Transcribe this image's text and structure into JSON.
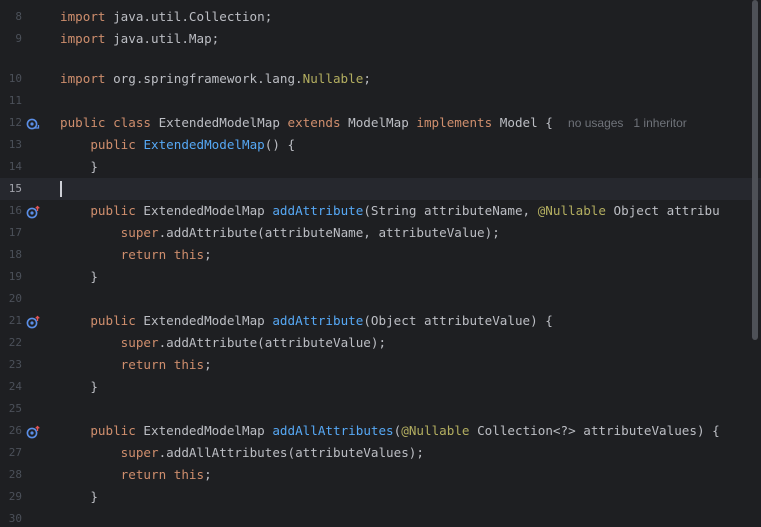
{
  "editor": {
    "current_line": "15",
    "lines": [
      {
        "num": "8",
        "indent": "",
        "tokens": [
          [
            "kw",
            "import"
          ],
          [
            "t",
            " java.util.Collection;"
          ]
        ]
      },
      {
        "num": "9",
        "indent": "",
        "tokens": [
          [
            "kw",
            "import"
          ],
          [
            "t",
            " java.util.Map;"
          ]
        ]
      },
      {
        "num": "10",
        "indent": "",
        "tokens": [
          [
            "kw",
            "import"
          ],
          [
            "t",
            " org.springframework.lang."
          ],
          [
            "an",
            "Nullable"
          ],
          [
            "t",
            ";"
          ]
        ]
      },
      {
        "num": "11",
        "indent": "",
        "tokens": []
      },
      {
        "num": "12",
        "indent": "",
        "icon": "implementation-icon",
        "tokens": [
          [
            "kw",
            "public class"
          ],
          [
            "t",
            " ExtendedModelMap "
          ],
          [
            "kw",
            "extends"
          ],
          [
            "t",
            " ModelMap "
          ],
          [
            "kw",
            "implements"
          ],
          [
            "t",
            " Model {  "
          ],
          [
            "hint",
            "no usages   1 inheritor"
          ]
        ]
      },
      {
        "num": "13",
        "indent": "    ",
        "tokens": [
          [
            "kw",
            "public"
          ],
          [
            "t",
            " "
          ],
          [
            "fn",
            "ExtendedModelMap"
          ],
          [
            "t",
            "() {"
          ]
        ]
      },
      {
        "num": "14",
        "indent": "    ",
        "tokens": [
          [
            "t",
            "}"
          ]
        ]
      },
      {
        "num": "15",
        "indent": "",
        "tokens": []
      },
      {
        "num": "16",
        "indent": "    ",
        "icon": "override-icon",
        "tokens": [
          [
            "kw",
            "public"
          ],
          [
            "t",
            " ExtendedModelMap "
          ],
          [
            "fn",
            "addAttribute"
          ],
          [
            "t",
            "(String attributeName, "
          ],
          [
            "an",
            "@Nullable"
          ],
          [
            "t",
            " Object attribu"
          ]
        ]
      },
      {
        "num": "17",
        "indent": "        ",
        "tokens": [
          [
            "kw",
            "super"
          ],
          [
            "t",
            ".addAttribute(attributeName, attributeValue);"
          ]
        ]
      },
      {
        "num": "18",
        "indent": "        ",
        "tokens": [
          [
            "kw",
            "return this"
          ],
          [
            "t",
            ";"
          ]
        ]
      },
      {
        "num": "19",
        "indent": "    ",
        "tokens": [
          [
            "t",
            "}"
          ]
        ]
      },
      {
        "num": "20",
        "indent": "",
        "tokens": []
      },
      {
        "num": "21",
        "indent": "    ",
        "icon": "override-icon",
        "tokens": [
          [
            "kw",
            "public"
          ],
          [
            "t",
            " ExtendedModelMap "
          ],
          [
            "fn",
            "addAttribute"
          ],
          [
            "t",
            "(Object attributeValue) {"
          ]
        ]
      },
      {
        "num": "22",
        "indent": "        ",
        "tokens": [
          [
            "kw",
            "super"
          ],
          [
            "t",
            ".addAttribute(attributeValue);"
          ]
        ]
      },
      {
        "num": "23",
        "indent": "        ",
        "tokens": [
          [
            "kw",
            "return this"
          ],
          [
            "t",
            ";"
          ]
        ]
      },
      {
        "num": "24",
        "indent": "    ",
        "tokens": [
          [
            "t",
            "}"
          ]
        ]
      },
      {
        "num": "25",
        "indent": "",
        "tokens": []
      },
      {
        "num": "26",
        "indent": "    ",
        "icon": "override-icon",
        "tokens": [
          [
            "kw",
            "public"
          ],
          [
            "t",
            " ExtendedModelMap "
          ],
          [
            "fn",
            "addAllAttributes"
          ],
          [
            "t",
            "("
          ],
          [
            "an",
            "@Nullable"
          ],
          [
            "t",
            " Collection<?> attributeValues) {"
          ]
        ]
      },
      {
        "num": "27",
        "indent": "        ",
        "tokens": [
          [
            "kw",
            "super"
          ],
          [
            "t",
            ".addAllAttributes(attributeValues);"
          ]
        ]
      },
      {
        "num": "28",
        "indent": "        ",
        "tokens": [
          [
            "kw",
            "return this"
          ],
          [
            "t",
            ";"
          ]
        ]
      },
      {
        "num": "29",
        "indent": "    ",
        "tokens": [
          [
            "t",
            "}"
          ]
        ]
      },
      {
        "num": "30",
        "indent": "",
        "tokens": []
      }
    ]
  },
  "colors": {
    "background": "#1e1f22",
    "keyword": "#cf8e6d",
    "method": "#56a8f5",
    "annotation": "#b3ae60",
    "text": "#bcbec4",
    "hint": "#6f737a",
    "line_number": "#4b5059"
  }
}
